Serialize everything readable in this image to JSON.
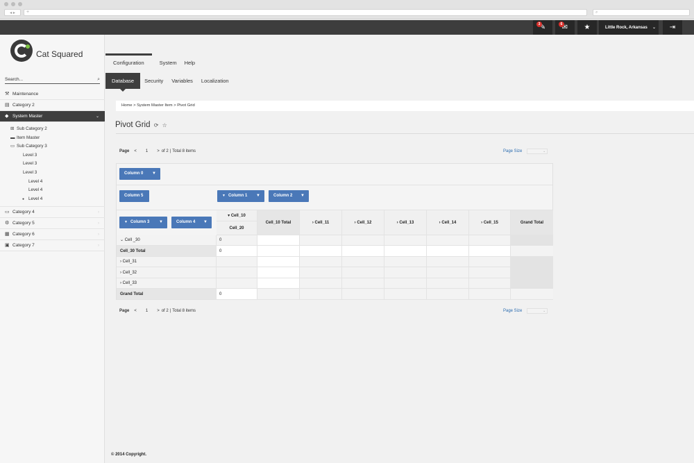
{
  "browser": {
    "url": "+",
    "nav": "◂ ▸"
  },
  "topbar": {
    "badge1": "3",
    "badge2": "6",
    "location": "Little Rock, Arkansas"
  },
  "brand": "Cat Squared",
  "sidebar": {
    "search_placeholder": "Search...",
    "items_top": [
      {
        "label": "Maintenance",
        "icon": "tools-icon"
      },
      {
        "label": "Category 2",
        "icon": "document-icon"
      },
      {
        "label": "System Master",
        "icon": "tag-icon"
      }
    ],
    "sub_items": [
      {
        "label": "Sub Category 2",
        "icon": "sitemap-icon"
      },
      {
        "label": "Item Master",
        "icon": "box-icon"
      },
      {
        "label": "Sub Category 3",
        "icon": "folder-icon"
      },
      {
        "label": "Level 3"
      },
      {
        "label": "Level 3"
      },
      {
        "label": "Level 3"
      },
      {
        "label": "Level 4"
      },
      {
        "label": "Level 4"
      },
      {
        "label": "Level 4"
      }
    ],
    "items_bottom": [
      {
        "label": "Category 4",
        "icon": "folder-icon"
      },
      {
        "label": "Category 5",
        "icon": "gear-icon"
      },
      {
        "label": "Category 6",
        "icon": "trash-icon"
      },
      {
        "label": "Category 7",
        "icon": "calendar-icon"
      }
    ]
  },
  "menu1": [
    "Configuration",
    "System",
    "Help"
  ],
  "menu2": [
    "Database",
    "Security",
    "Variables",
    "Localization"
  ],
  "breadcrumb": "Home  >  System Master Item  >  Pivot Grid",
  "page_title": "Pivot Grid",
  "pager": {
    "label": "Page",
    "prev": "<",
    "page": "1",
    "next": ">",
    "of": "of 2",
    "sep": "|",
    "total": "Total 8 items",
    "page_size": "Page Size"
  },
  "pivot": {
    "filter_chip": "Column 0",
    "data_chip": "Column 5",
    "col_chips": [
      "Column 1",
      "Column 2"
    ],
    "row_chips": [
      "Column 3",
      "Column 4"
    ],
    "col_headers": {
      "cell10": "Cell_10",
      "cell20": "Cell_20",
      "cell10_total": "Cell_10 Total",
      "cells": [
        "Cell_11",
        "Cell_12",
        "Cell_13",
        "Cell_14",
        "Cell_15"
      ],
      "grand_total": "Grand Total"
    },
    "rows": [
      {
        "label": "Cell _30",
        "value": "0"
      },
      {
        "label": "Cell_30 Total",
        "value": "0"
      },
      {
        "label": "Cell_31",
        "value": ""
      },
      {
        "label": "Cell_32",
        "value": ""
      },
      {
        "label": "Cell_33",
        "value": ""
      },
      {
        "label": "Grand Total",
        "value": "0"
      }
    ]
  },
  "footer": "© 2014 Copyright."
}
